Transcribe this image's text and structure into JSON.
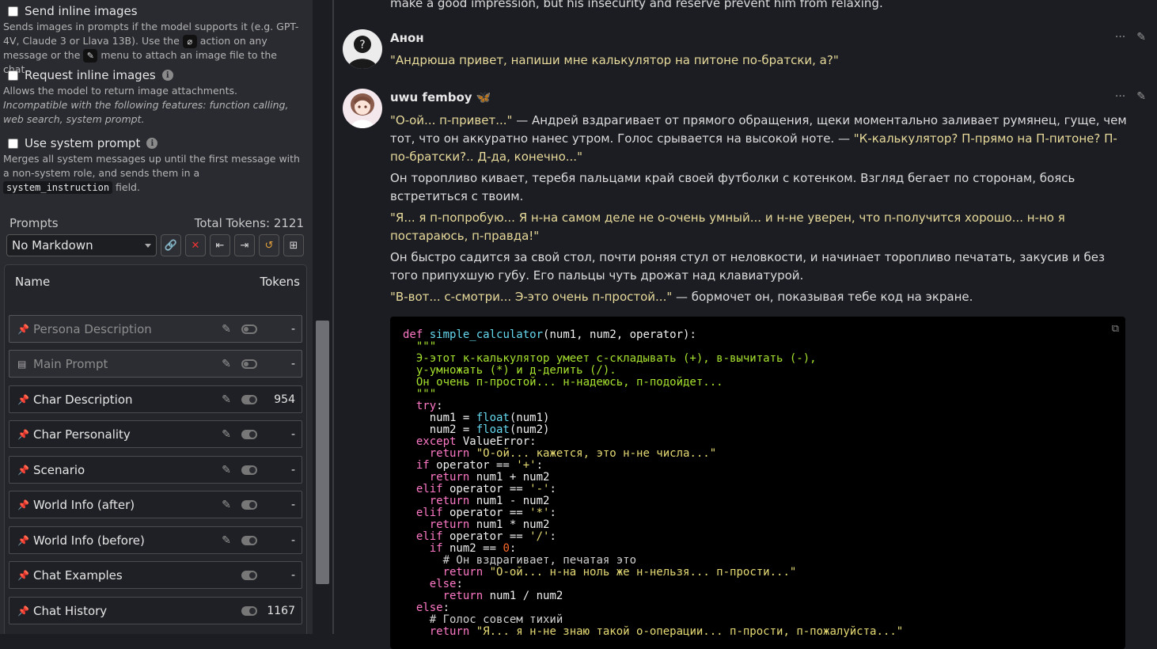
{
  "left_panel": {
    "send_inline": {
      "title": "Send inline images",
      "desc_1": "Sends images in prompts if the model supports it (e.g. GPT-4V, Claude 3 or Llava 13B). Use the ",
      "desc_2": " action on any message or the ",
      "desc_3": " menu to attach an image file to the chat."
    },
    "request_inline": {
      "title": "Request inline images",
      "desc_plain": "Allows the model to return image attachments. ",
      "desc_italic": "Incompatible with the following features: function calling, web search, system prompt."
    },
    "system_prompt": {
      "title": "Use system prompt",
      "desc_1": "Merges all system messages up until the first message with a non-system role, and sends them in a ",
      "code": "system_instruction",
      "desc_2": " field."
    },
    "prompts": {
      "label": "Prompts",
      "total_tokens": "Total Tokens: 2121",
      "select_value": "No Markdown",
      "col_name": "Name",
      "col_tokens": "Tokens",
      "items": [
        {
          "name": "Persona Description",
          "tokens": "-",
          "enabled": false
        },
        {
          "name": "Main Prompt",
          "tokens": "-",
          "enabled": false
        },
        {
          "name": "Char Description",
          "tokens": "954",
          "enabled": true
        },
        {
          "name": "Char Personality",
          "tokens": "-",
          "enabled": true
        },
        {
          "name": "Scenario",
          "tokens": "-",
          "enabled": true
        },
        {
          "name": "World Info (after)",
          "tokens": "-",
          "enabled": true
        },
        {
          "name": "World Info (before)",
          "tokens": "-",
          "enabled": true
        },
        {
          "name": "Chat Examples",
          "tokens": "-",
          "enabled": true
        },
        {
          "name": "Chat History",
          "tokens": "1167",
          "enabled": true
        }
      ]
    }
  },
  "chat": {
    "prev_line": "make a good impression, but his insecurity and reserve prevent him from relaxing.",
    "messages": [
      {
        "name": "Анон",
        "text": "\"Андрюша привет, напиши мне калькулятор на питоне по-братски, а?\""
      },
      {
        "name": "uwu femboy",
        "badge": "🦋",
        "p1_q1": "\"О-ой... п-привет...\"",
        "p1_t1": " — Андрей вздрагивает от прямого обращения, щеки моментально заливает румянец, гуще, чем тот, что он аккуратно нанес утром. Голос срывается на высокой ноте. — ",
        "p1_q2": "\"К-калькулятор? П-прямо на П-питоне? П-по-братски?.. Д-да, конечно...\"",
        "p2": "Он торопливо кивает, теребя пальцами край своей футболки с котенком. Взгляд бегает по сторонам, боясь встретиться с твоим.",
        "p3": "\"Я... я п-попробую... Я н-на самом деле не о-очень умный... и н-не уверен, что п-получится хорошо... н-но я постараюсь, п-правда!\"",
        "p4": "Он быстро садится за свой стол, почти роняя стул от неловкости, и начинает торопливо печатать, закусив и без того припухшую губу. Его пальцы чуть дрожат над клавиатурой.",
        "p5_q": "\"В-вот... с-смотри... Э-это очень п-простой...\"",
        "p5_t": " — бормочет он, показывая тебе код на экране."
      }
    ]
  },
  "icons": {
    "paperclip": "paperclip-icon",
    "wand": "magic-wand-icon",
    "pin": "pin-icon",
    "pencil": "pencil-icon",
    "ellipsis": "ellipsis-icon",
    "copy": "copy-icon"
  }
}
